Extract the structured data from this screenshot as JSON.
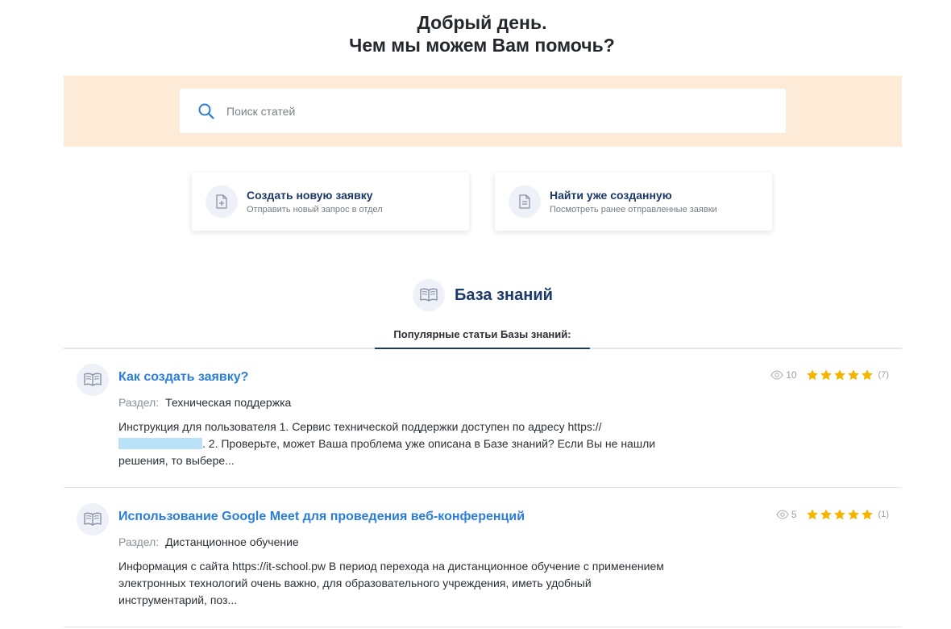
{
  "hero": {
    "line1": "Добрый день.",
    "line2": "Чем мы можем Вам помочь?"
  },
  "search": {
    "placeholder": "Поиск статей",
    "value": ""
  },
  "actions": [
    {
      "title": "Создать новую заявку",
      "subtitle": "Отправить новый запрос в отдел",
      "icon": "document-plus-icon"
    },
    {
      "title": "Найти уже созданную",
      "subtitle": "Посмотреть ранее отправленные заявки",
      "icon": "document-lines-icon"
    }
  ],
  "knowledge_base": {
    "title": "База знаний",
    "icon": "book-icon",
    "tab_label": "Популярные статьи Базы знаний:"
  },
  "articles": [
    {
      "title": "Как создать заявку?",
      "section_label": "Раздел:",
      "section": "Техническая поддержка",
      "excerpt_part1": "Инструкция для пользователя 1. Сервис технической поддержки доступен по адресу https://",
      "excerpt_part2": ". 2. Проверьте, может Ваша проблема уже описана в Базе знаний? Если Вы не нашли решения, то выбере...",
      "views": "10",
      "rating": 5,
      "rating_count": "(7)"
    },
    {
      "title": "Использование Google Meet для проведения веб-конференций",
      "section_label": "Раздел:",
      "section": "Дистанционное обучение",
      "excerpt_part1": "Информация с сайта https://it-school.pw В период перехода на дистанционное обучение с применением электронных технологий очень важно, для образовательного учреждения, иметь удобный инструментарий, поз...",
      "excerpt_part2": "",
      "views": "5",
      "rating": 5,
      "rating_count": "(1)"
    }
  ],
  "colors": {
    "accent_link": "#2a7ed9",
    "navy": "#1a3a6b",
    "search_band": "#fdebd8",
    "star": "#f5b400"
  }
}
